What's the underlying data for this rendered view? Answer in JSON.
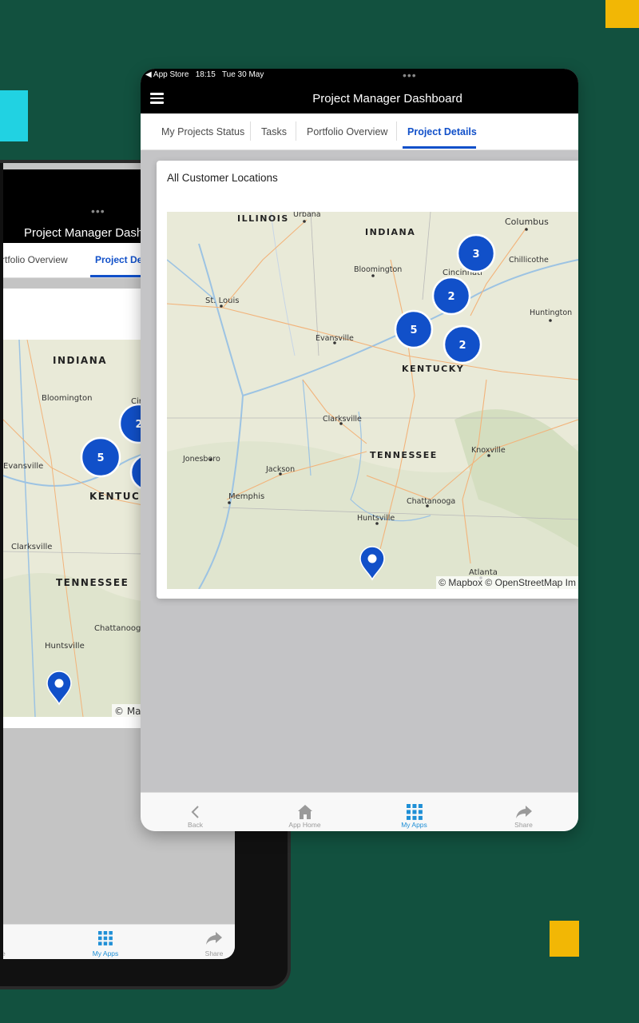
{
  "status_bar": {
    "carrier": "◀ App Store",
    "time": "18:15",
    "date": "Tue 30 May",
    "dots": "•••"
  },
  "header": {
    "title": "Project Manager Dashboard",
    "menu_icon": "hamburger-icon"
  },
  "tabs": [
    {
      "label": "My Projects Status"
    },
    {
      "label": "Tasks"
    },
    {
      "label": "Portfolio Overview"
    },
    {
      "label": "Project Details",
      "active": true
    }
  ],
  "card": {
    "title": "All Customer Locations"
  },
  "map": {
    "attribution": "© Mapbox © OpenStreetMap Im",
    "labels": {
      "illinois": "ILLINOIS",
      "indiana": "INDIANA",
      "kentucky": "KENTUCKY",
      "tennessee": "TENNESSEE",
      "urbana": "Urbana",
      "columbus": "Columbus",
      "chillicothe": "Chillicothe",
      "cincinnati": "Cincinnati",
      "bloomington": "Bloomington",
      "st_louis": "St. Louis",
      "huntington": "Huntington",
      "evansville": "Evansville",
      "clarksville": "Clarksville",
      "knoxville": "Knoxville",
      "jonesboro": "Jonesboro",
      "jackson": "Jackson",
      "memphis": "Memphis",
      "chattanooga": "Chattanooga",
      "huntsville": "Huntsville",
      "atlanta": "Atlanta"
    },
    "clusters": [
      {
        "count": "3"
      },
      {
        "count": "2"
      },
      {
        "count": "5"
      },
      {
        "count": "2"
      }
    ],
    "pin": "map-pin-icon"
  },
  "bottom_nav": [
    {
      "label": "Back",
      "icon": "chevron-left-icon"
    },
    {
      "label": "App Home",
      "icon": "home-icon"
    },
    {
      "label": "My Apps",
      "icon": "grid-icon",
      "active": true
    },
    {
      "label": "Share",
      "icon": "share-arrow-icon"
    }
  ],
  "back_tablet": {
    "title": "Project Manager Dashb",
    "tab_portfolio": "rtfolio Overview",
    "tab_details": "Project Det",
    "labels": {
      "indiana": "INDIANA",
      "kentucky": "KENTUCKY",
      "tennessee": "TENNESSEE",
      "bloomington": "Bloomington",
      "evansville": "Evansville",
      "clarksville": "Clarksville",
      "chattanooga": "Chattanooga",
      "huntsville": "Huntsville",
      "cin": "Cin"
    },
    "clusters": [
      {
        "count": "2"
      },
      {
        "count": "5"
      }
    ],
    "attribution": "© Map",
    "nav": [
      {
        "label": "e"
      },
      {
        "label": "My Apps"
      },
      {
        "label": "Share"
      }
    ]
  },
  "colors": {
    "accent": "#1150c9",
    "cluster": "#1150c9",
    "background": "#12513f",
    "yellow": "#f2b705",
    "cyan": "#21d2e2"
  }
}
